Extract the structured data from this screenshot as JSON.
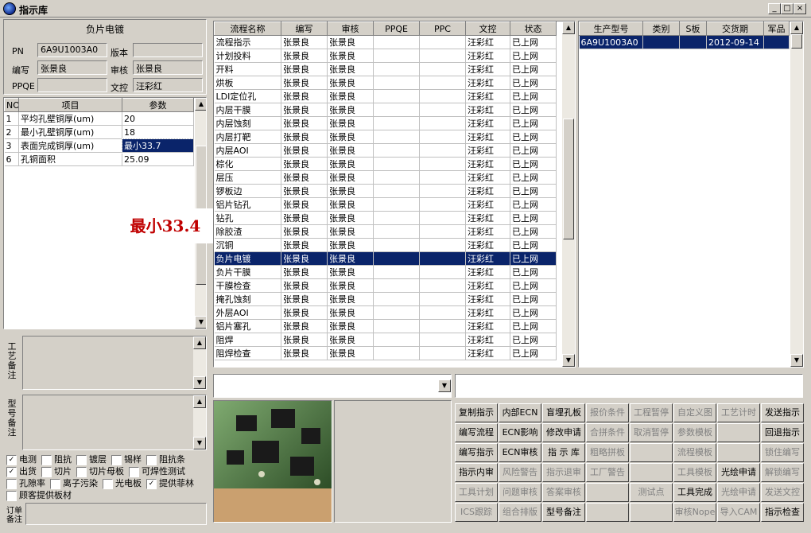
{
  "window": {
    "title": "指示库",
    "min": "_",
    "max": "□",
    "close": "×"
  },
  "header": {
    "process_title": "负片电镀",
    "pn_label": "PN",
    "pn_value": "6A9U1003A0",
    "version_label": "版本",
    "version_value": "",
    "writer_label": "编写",
    "writer_value": "张景良",
    "reviewer_label": "审核",
    "reviewer_value": "张景良",
    "ppqe_label": "PPQE",
    "ppqe_value": "",
    "doc_label": "文控",
    "doc_value": "汪彩红"
  },
  "params": {
    "columns": [
      "NO",
      "项目",
      "参数"
    ],
    "rows": [
      {
        "no": "1",
        "item": "平均孔壁铜厚(um)",
        "value": "20"
      },
      {
        "no": "2",
        "item": "最小孔壁铜厚(um)",
        "value": "18"
      },
      {
        "no": "3",
        "item": "表面完成铜厚(um)",
        "value": "最小33.7"
      },
      {
        "no": "6",
        "item": "孔铜面积",
        "value": "25.09"
      }
    ]
  },
  "tooltip": "最小33.4",
  "notes": {
    "process_note_label": "工艺备注",
    "model_note_label": "型号备注",
    "order_note_label": "订单备注"
  },
  "checkboxes": [
    [
      {
        "label": "电测",
        "checked": true
      },
      {
        "label": "阻抗",
        "checked": false
      },
      {
        "label": "镀层",
        "checked": false
      },
      {
        "label": "锡样",
        "checked": false
      },
      {
        "label": "阻抗条",
        "checked": false
      }
    ],
    [
      {
        "label": "出货",
        "checked": true
      },
      {
        "label": "切片",
        "checked": false
      },
      {
        "label": "切片母板",
        "checked": false
      },
      {
        "label": "可焊性测试",
        "checked": false
      }
    ],
    [
      {
        "label": "孔隙率",
        "checked": false
      },
      {
        "label": "离子污染",
        "checked": false
      },
      {
        "label": "光电板",
        "checked": false
      },
      {
        "label": "提供菲林",
        "checked": true
      }
    ],
    [
      {
        "label": "顾客提供板材",
        "checked": false
      }
    ]
  ],
  "flow": {
    "columns": [
      "流程名称",
      "编写",
      "审核",
      "PPQE",
      "PPC",
      "文控",
      "状态"
    ],
    "rows": [
      [
        "流程指示",
        "张景良",
        "张景良",
        "",
        "",
        "汪彩红",
        "已上网"
      ],
      [
        "计划投料",
        "张景良",
        "张景良",
        "",
        "",
        "汪彩红",
        "已上网"
      ],
      [
        "开料",
        "张景良",
        "张景良",
        "",
        "",
        "汪彩红",
        "已上网"
      ],
      [
        "烘板",
        "张景良",
        "张景良",
        "",
        "",
        "汪彩红",
        "已上网"
      ],
      [
        "LDI定位孔",
        "张景良",
        "张景良",
        "",
        "",
        "汪彩红",
        "已上网"
      ],
      [
        "内层干膜",
        "张景良",
        "张景良",
        "",
        "",
        "汪彩红",
        "已上网"
      ],
      [
        "内层蚀刻",
        "张景良",
        "张景良",
        "",
        "",
        "汪彩红",
        "已上网"
      ],
      [
        "内层打靶",
        "张景良",
        "张景良",
        "",
        "",
        "汪彩红",
        "已上网"
      ],
      [
        "内层AOI",
        "张景良",
        "张景良",
        "",
        "",
        "汪彩红",
        "已上网"
      ],
      [
        "棕化",
        "张景良",
        "张景良",
        "",
        "",
        "汪彩红",
        "已上网"
      ],
      [
        "层压",
        "张景良",
        "张景良",
        "",
        "",
        "汪彩红",
        "已上网"
      ],
      [
        "锣板边",
        "张景良",
        "张景良",
        "",
        "",
        "汪彩红",
        "已上网"
      ],
      [
        "铝片钻孔",
        "张景良",
        "张景良",
        "",
        "",
        "汪彩红",
        "已上网"
      ],
      [
        "钻孔",
        "张景良",
        "张景良",
        "",
        "",
        "汪彩红",
        "已上网"
      ],
      [
        "除胶渣",
        "张景良",
        "张景良",
        "",
        "",
        "汪彩红",
        "已上网"
      ],
      [
        "沉铜",
        "张景良",
        "张景良",
        "",
        "",
        "汪彩红",
        "已上网"
      ],
      [
        "负片电镀",
        "张景良",
        "张景良",
        "",
        "",
        "汪彩红",
        "已上网"
      ],
      [
        "负片干膜",
        "张景良",
        "张景良",
        "",
        "",
        "汪彩红",
        "已上网"
      ],
      [
        "干膜检查",
        "张景良",
        "张景良",
        "",
        "",
        "汪彩红",
        "已上网"
      ],
      [
        "掩孔蚀刻",
        "张景良",
        "张景良",
        "",
        "",
        "汪彩红",
        "已上网"
      ],
      [
        "外层AOI",
        "张景良",
        "张景良",
        "",
        "",
        "汪彩红",
        "已上网"
      ],
      [
        "铝片塞孔",
        "张景良",
        "张景良",
        "",
        "",
        "汪彩红",
        "已上网"
      ],
      [
        "阻焊",
        "张景良",
        "张景良",
        "",
        "",
        "汪彩红",
        "已上网"
      ],
      [
        "阻焊检查",
        "张景良",
        "张景良",
        "",
        "",
        "汪彩红",
        "已上网"
      ]
    ],
    "selected_index": 16
  },
  "products": {
    "columns": [
      "生产型号",
      "类别",
      "S板",
      "交货期",
      "军品"
    ],
    "rows": [
      [
        "6A9U1003A0",
        "",
        "",
        "2012-09-14",
        ""
      ]
    ]
  },
  "buttons": [
    [
      {
        "label": "复制指示",
        "enabled": true
      },
      {
        "label": "内部ECN",
        "enabled": true
      },
      {
        "label": "盲埋孔板",
        "enabled": true
      },
      {
        "label": "报价条件",
        "enabled": false
      },
      {
        "label": "工程暂停",
        "enabled": false
      },
      {
        "label": "自定义图",
        "enabled": false
      },
      {
        "label": "工艺计时",
        "enabled": false
      },
      {
        "label": "发送指示",
        "enabled": true
      }
    ],
    [
      {
        "label": "编写流程",
        "enabled": true
      },
      {
        "label": "ECN影响",
        "enabled": true
      },
      {
        "label": "修改申请",
        "enabled": true
      },
      {
        "label": "合拼条件",
        "enabled": false
      },
      {
        "label": "取消暂停",
        "enabled": false
      },
      {
        "label": "参数模板",
        "enabled": false
      },
      {
        "label": "",
        "enabled": false
      },
      {
        "label": "回退指示",
        "enabled": true
      }
    ],
    [
      {
        "label": "编写指示",
        "enabled": true
      },
      {
        "label": "ECN审核",
        "enabled": true
      },
      {
        "label": "指 示 库",
        "enabled": true
      },
      {
        "label": "粗略拼板",
        "enabled": false
      },
      {
        "label": "",
        "enabled": false
      },
      {
        "label": "流程模板",
        "enabled": false
      },
      {
        "label": "",
        "enabled": false
      },
      {
        "label": "锁住编写",
        "enabled": false
      }
    ],
    [
      {
        "label": "指示内审",
        "enabled": true
      },
      {
        "label": "风险警告",
        "enabled": false
      },
      {
        "label": "指示退审",
        "enabled": false
      },
      {
        "label": "工厂警告",
        "enabled": false
      },
      {
        "label": "",
        "enabled": false
      },
      {
        "label": "工具模板",
        "enabled": false
      },
      {
        "label": "光绘申请",
        "enabled": true
      },
      {
        "label": "解锁编写",
        "enabled": false
      }
    ],
    [
      {
        "label": "工具计划",
        "enabled": false
      },
      {
        "label": "问题审核",
        "enabled": false
      },
      {
        "label": "答案审核",
        "enabled": false
      },
      {
        "label": "",
        "enabled": false
      },
      {
        "label": "测试点",
        "enabled": false
      },
      {
        "label": "工具完成",
        "enabled": true
      },
      {
        "label": "光绘申请",
        "enabled": false
      },
      {
        "label": "发送文控",
        "enabled": false
      }
    ],
    [
      {
        "label": "ICS跟踪",
        "enabled": false
      },
      {
        "label": "组合排版",
        "enabled": false
      },
      {
        "label": "型号备注",
        "enabled": true
      },
      {
        "label": "",
        "enabled": false
      },
      {
        "label": "",
        "enabled": false
      },
      {
        "label": "审核Nope",
        "enabled": false
      },
      {
        "label": "导入CAM",
        "enabled": false
      },
      {
        "label": "指示检查",
        "enabled": true
      }
    ]
  ],
  "colors": {
    "selection": "#0a246a",
    "face": "#d4d0c8",
    "tooltip_text": "#c00000"
  }
}
